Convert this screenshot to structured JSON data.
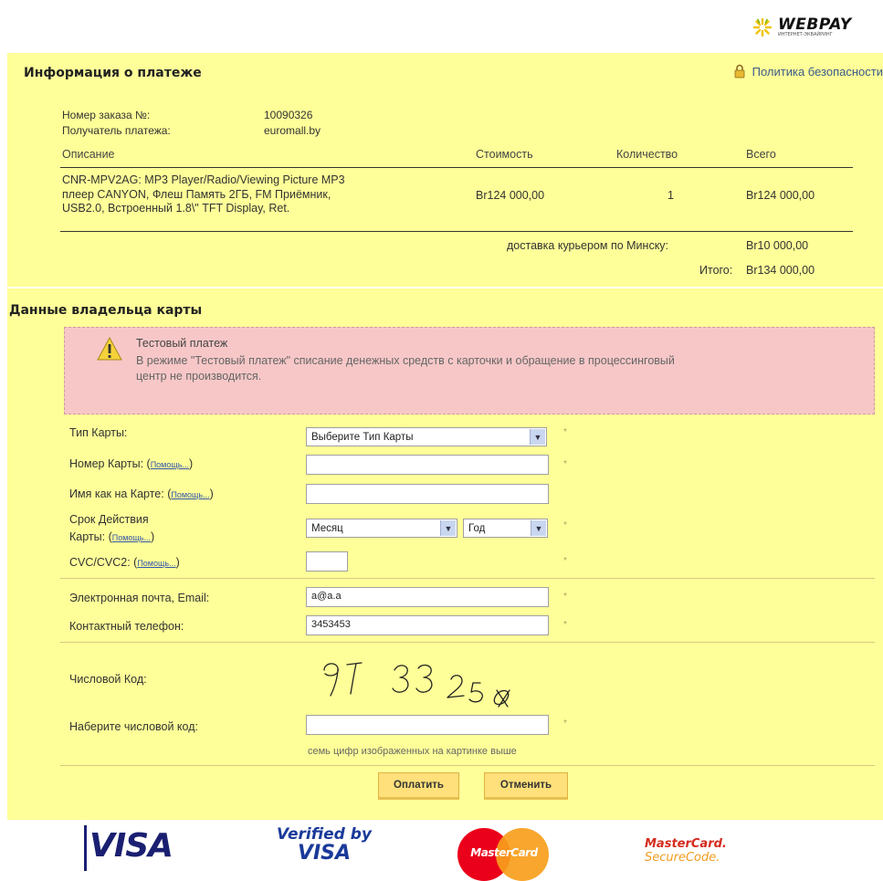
{
  "brand": {
    "logo_text": "WEBPAY",
    "logo_sub": "ИНТЕРНЕТ-ЭКВАЙРИНГ"
  },
  "payment_info": {
    "title": "Информация о платеже",
    "policy_link": "Политика безопасности",
    "order_label": "Номер заказа №:",
    "order_value": "10090326",
    "recipient_label": "Получатель платежа:",
    "recipient_value": "euromall.by",
    "columns": [
      "Описание",
      "Стоимость",
      "Количество",
      "Всего"
    ],
    "item": {
      "description_lines": [
        "CNR-MPV2AG: MP3 Player/Radio/Viewing Picture MP3",
        "плеер CANYON, Флеш Память 2ГБ, FM Приёмник,",
        "USB2.0, Встроенный 1.8\\\" TFT Display, Ret."
      ],
      "price": "Br124 000,00",
      "quantity": "1",
      "total": "Br124 000,00"
    },
    "delivery_label": "доставка курьером по Минску:",
    "delivery_value": "Br10 000,00",
    "grand_total_label": "Итого:",
    "grand_total_value": "Br134 000,00"
  },
  "cardholder": {
    "title": "Данные владельца карты",
    "test_title": "Тестовый платеж",
    "test_text_line1": "В режиме \"Тестовый платеж\" списание денежных средств с карточки и обращение в процессинговый",
    "test_text_line2": "центр не производится.",
    "help_text": "Помощь...",
    "card_type_label": "Тип Карты:",
    "card_type_value": "Выберите Тип Карты",
    "card_number_label": "Номер Карты:",
    "card_number_value": "",
    "name_label": "Имя как на Карте:",
    "name_value": "",
    "expiry_label_line1": "Срок Действия",
    "expiry_label_line2": "Карты:",
    "month_value": "Месяц",
    "year_value": "Год",
    "cvc_label": "CVC/CVC2:",
    "cvc_value": "",
    "email_label": "Электронная почта, Email:",
    "email_value": "a@a.a",
    "phone_label": "Контактный телефон:",
    "phone_value": "3453453",
    "captcha_label": "Числовой Код:",
    "captcha_image_text": "9733258",
    "captcha_input_label": "Наберите числовой код:",
    "captcha_input_value": "",
    "captcha_hint": "семь цифр изображенных на картинке выше",
    "required_mark": "*"
  },
  "actions": {
    "pay_label": "Оплатить",
    "cancel_label": "Отменить"
  },
  "footer_logos": {
    "visa": "VISA",
    "verified_top": "Verified by",
    "verified_bottom": "VISA",
    "mastercard": "MasterCard",
    "securecode_top": "MasterCard.",
    "securecode_bottom": "SecureCode."
  },
  "colors": {
    "panel": "#ffff99",
    "warning_bg": "#f7c7c7",
    "button": "#ffe07a",
    "link": "#3b5b8b",
    "visa_blue": "#1a1f71",
    "mc_red": "#eb001b",
    "mc_orange": "#f79e1b"
  }
}
